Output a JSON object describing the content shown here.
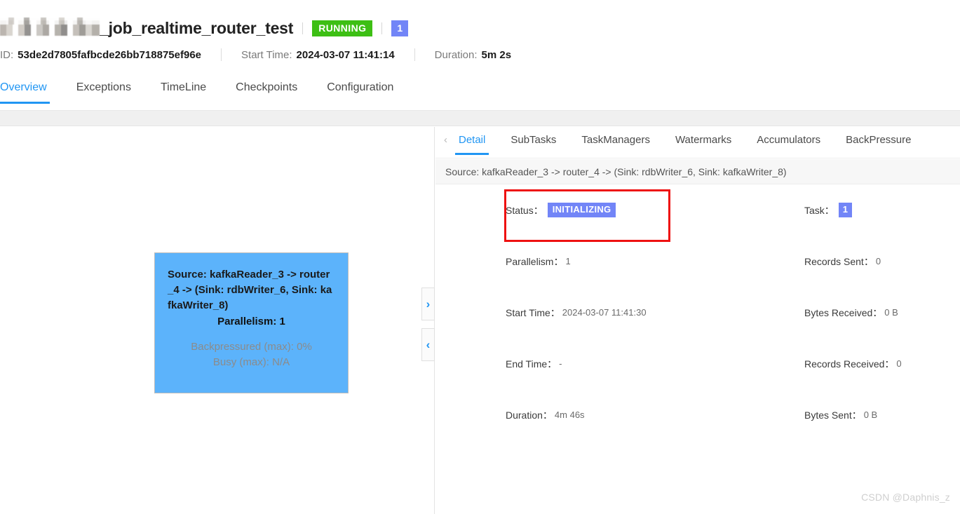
{
  "header": {
    "job_name": "_job_realtime_router_test",
    "redacted_prefix_label": "redacted-job-prefix",
    "status_badge": "RUNNING",
    "count_badge": "1",
    "id_label": "ID:",
    "id_value": "53de2d7805fafbcde26bb718875ef96e",
    "start_time_label": "Start Time:",
    "start_time_value": "2024-03-07 11:41:14",
    "duration_label": "Duration:",
    "duration_value": "5m 2s"
  },
  "main_tabs": [
    {
      "label": "Overview",
      "active": true
    },
    {
      "label": "Exceptions",
      "active": false
    },
    {
      "label": "TimeLine",
      "active": false
    },
    {
      "label": "Checkpoints",
      "active": false
    },
    {
      "label": "Configuration",
      "active": false
    }
  ],
  "graph": {
    "node": {
      "name": "Source: kafkaReader_3 -> router_4 -> (Sink: rdbWriter_6, Sink: kafkaWriter_8)",
      "parallelism": "Parallelism: 1",
      "backpressured": "Backpressured (max): 0%",
      "busy": "Busy (max): N/A"
    },
    "handle_open_icon": "›",
    "handle_close_icon": "‹"
  },
  "detail_panel": {
    "back_chevron": "‹",
    "tabs": [
      {
        "label": "Detail",
        "active": true
      },
      {
        "label": "SubTasks",
        "active": false
      },
      {
        "label": "TaskManagers",
        "active": false
      },
      {
        "label": "Watermarks",
        "active": false
      },
      {
        "label": "Accumulators",
        "active": false
      },
      {
        "label": "BackPressure",
        "active": false
      }
    ],
    "subtitle": "Source: kafkaReader_3 -> router_4 -> (Sink: rdbWriter_6, Sink: kafkaWriter_8)",
    "rows": [
      {
        "left_label": "Status",
        "left_value": "INITIALIZING",
        "left_is_badge": true,
        "right_label": "Task",
        "right_value": "1",
        "right_is_badge": true
      },
      {
        "left_label": "Parallelism",
        "left_value": "1",
        "left_is_badge": false,
        "right_label": "Records Sent",
        "right_value": "0",
        "right_is_badge": false
      },
      {
        "left_label": "Start Time",
        "left_value": "2024-03-07 11:41:30",
        "left_is_badge": false,
        "right_label": "Bytes Received",
        "right_value": "0 B",
        "right_is_badge": false
      },
      {
        "left_label": "End Time",
        "left_value": "-",
        "left_is_badge": false,
        "right_label": "Records Received",
        "right_value": "0",
        "right_is_badge": false
      },
      {
        "left_label": "Duration",
        "left_value": "4m 46s",
        "left_is_badge": false,
        "right_label": "Bytes Sent",
        "right_value": "0 B",
        "right_is_badge": false
      }
    ]
  },
  "watermark": "CSDN @Daphnis_z",
  "colors": {
    "accent_blue": "#2196f3",
    "status_running_green": "#3dbf14",
    "badge_purple_blue": "#7285f7",
    "node_fill_blue": "#5cb3fb",
    "annotation_red": "#ee1111"
  }
}
